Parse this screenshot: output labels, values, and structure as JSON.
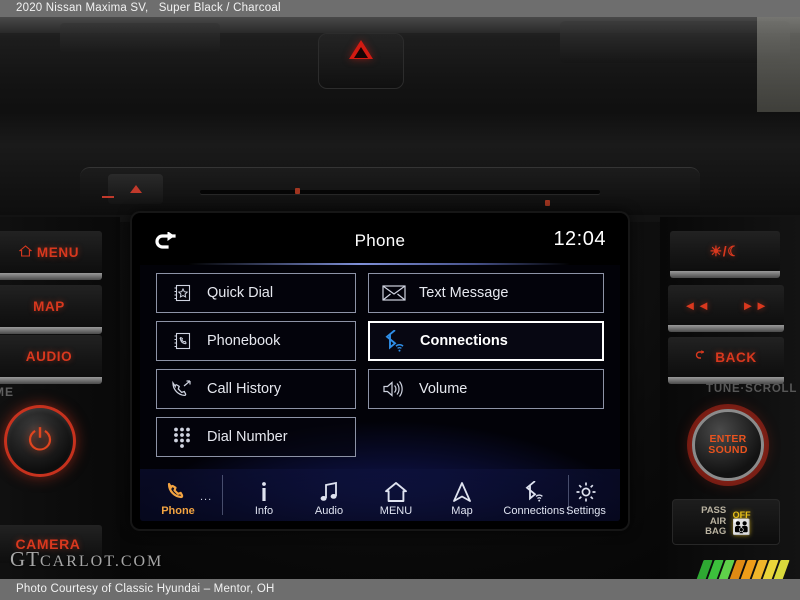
{
  "top_banner": {
    "vehicle": "2020 Nissan Maxima SV,",
    "colors": "Super Black / Charcoal"
  },
  "bottom_banner": {
    "credit": "Photo Courtesy of Classic Hyundai – Mentor, OH"
  },
  "watermark": {
    "gt": "GT",
    "carlot": "CARLOT.COM"
  },
  "colors": {
    "screen_accent_blue": "#2d39a8",
    "bluetooth_blue": "#2f8fe8",
    "active_nav_amber": "#f2a341",
    "hard_button_red": "#d9381e",
    "airbag_amber": "#e8c018"
  },
  "screen": {
    "header": {
      "back_icon": "back-arrow-icon",
      "title": "Phone",
      "clock": "12:04"
    },
    "tiles": [
      {
        "label": "Quick Dial",
        "icon": "quick-dial-star-book-icon",
        "selected": false
      },
      {
        "label": "Text Message",
        "icon": "envelope-icon",
        "selected": false
      },
      {
        "label": "Phonebook",
        "icon": "phonebook-icon",
        "selected": false
      },
      {
        "label": "Connections",
        "icon": "bluetooth-wifi-icon",
        "selected": true
      },
      {
        "label": "Call History",
        "icon": "call-history-handset-icon",
        "selected": false
      },
      {
        "label": "Volume",
        "icon": "speaker-volume-icon",
        "selected": false
      },
      {
        "label": "Dial Number",
        "icon": "keypad-dots-icon",
        "selected": false
      }
    ],
    "navbar": [
      {
        "label": "Phone",
        "icon": "handset-icon",
        "active": true
      },
      {
        "label": "Info",
        "icon": "info-i-icon",
        "active": false
      },
      {
        "label": "Audio",
        "icon": "music-note-icon",
        "active": false
      },
      {
        "label": "MENU",
        "icon": "home-icon",
        "active": false
      },
      {
        "label": "Map",
        "icon": "navigation-arrow-icon",
        "active": false
      },
      {
        "label": "Connections",
        "icon": "bluetooth-wifi-icon",
        "active": false
      },
      {
        "label": "Settings",
        "icon": "gear-icon",
        "active": false
      }
    ],
    "nav_overflow_dots": "..."
  },
  "hard_buttons": {
    "left": [
      {
        "label": "MENU",
        "icon": "home-icon"
      },
      {
        "label": "MAP",
        "icon": ""
      },
      {
        "label": "AUDIO",
        "icon": ""
      },
      {
        "label": "CAMERA",
        "icon": ""
      }
    ],
    "volume_label": "ME",
    "power_knob": {
      "glyph": "⏻",
      "name": "power-volume-knob"
    },
    "right": [
      {
        "label": "☀/☾",
        "icon": "day-night-icon"
      },
      {
        "label": "BACK",
        "icon": "back-arrow-icon"
      }
    ],
    "track_prev": "◄◄",
    "track_next": "►►",
    "tune_label": "TUNE·SCROLL",
    "enter_knob": {
      "line1": "ENTER",
      "line2": "SOUND"
    }
  },
  "airbag_indicator": {
    "line1": "PASS",
    "line2": "AIR",
    "line3": "BAG",
    "status": "OFF",
    "figure": "occupant-airbag-off-icon"
  },
  "hazard_button": {
    "name": "hazard-warning-button"
  },
  "eject_button": {
    "name": "cd-eject-button"
  }
}
